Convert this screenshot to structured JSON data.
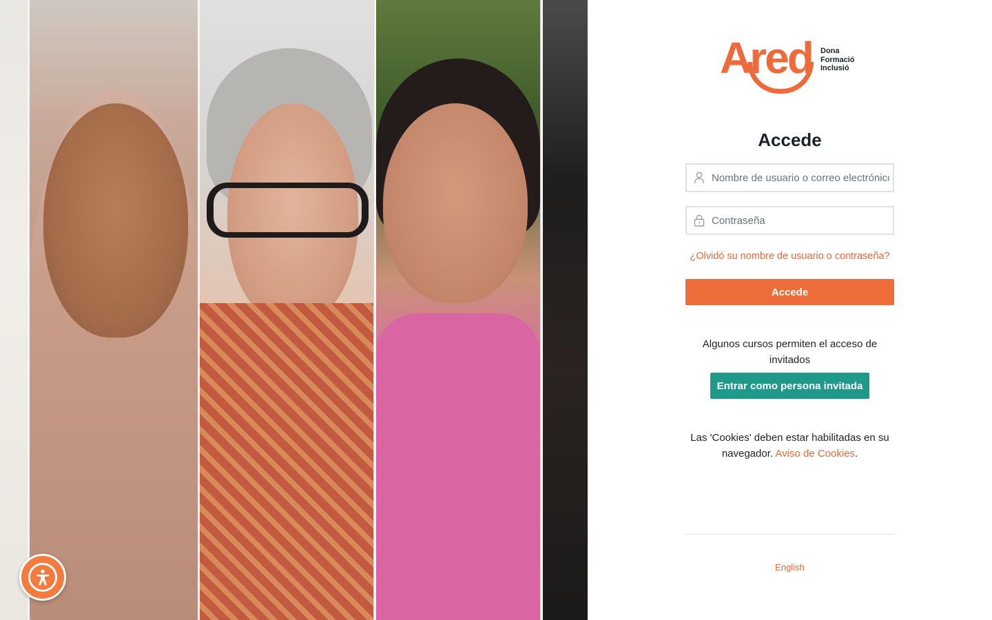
{
  "logo": {
    "word": "Ared",
    "tagline": [
      "Dona",
      "Formació",
      "Inclusió"
    ]
  },
  "login": {
    "title": "Accede",
    "username_placeholder": "Nombre de usuario o correo electrónico",
    "password_placeholder": "Contraseña",
    "forgot_link": "¿Olvidó su nombre de usuario o contraseña?",
    "submit_label": "Accede"
  },
  "guest": {
    "text": "Algunos cursos permiten el acceso de invitados",
    "button_label": "Entrar como persona invitada"
  },
  "cookies": {
    "text": "Las 'Cookies' deben estar habilitadas en su navegador.",
    "link_label": "Aviso de Cookies",
    "suffix": "."
  },
  "language": {
    "label": "English"
  },
  "colors": {
    "brand_orange": "#ee6b3a",
    "guest_teal": "#1f9a8a",
    "link_orange": "#e8693a"
  },
  "icons": {
    "user_field": "user-icon",
    "password_field": "lock-icon",
    "accessibility": "accessibility-icon"
  }
}
